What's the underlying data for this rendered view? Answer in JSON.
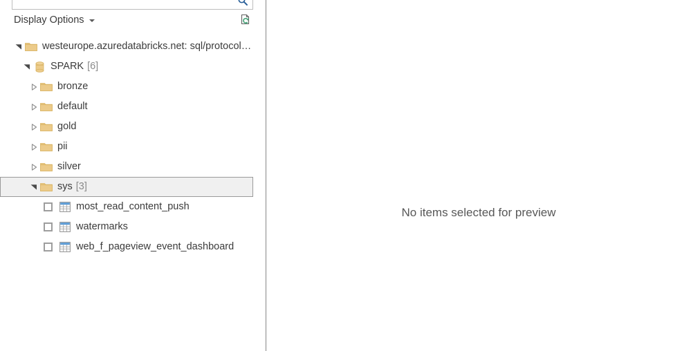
{
  "search": {
    "value": "",
    "placeholder": "",
    "icon": "search-icon"
  },
  "toolbar": {
    "display_options_label": "Display Options",
    "dropdown_icon": "chevron-down-icon",
    "refresh_icon": "refresh-page-icon"
  },
  "tree": {
    "nodes": [
      {
        "label": "westeurope.azuredatabricks.net: sql/protocolv...",
        "count": "",
        "icon": "folder-icon",
        "state": "expanded",
        "level": 0,
        "selected": false,
        "checkbox": false
      },
      {
        "label": "SPARK",
        "count": "[6]",
        "icon": "database-icon",
        "state": "expanded",
        "level": 1,
        "selected": false,
        "checkbox": false
      },
      {
        "label": "bronze",
        "count": "",
        "icon": "folder-icon",
        "state": "collapsed",
        "level": 2,
        "selected": false,
        "checkbox": false
      },
      {
        "label": "default",
        "count": "",
        "icon": "folder-icon",
        "state": "collapsed",
        "level": 2,
        "selected": false,
        "checkbox": false
      },
      {
        "label": "gold",
        "count": "",
        "icon": "folder-icon",
        "state": "collapsed",
        "level": 2,
        "selected": false,
        "checkbox": false
      },
      {
        "label": "pii",
        "count": "",
        "icon": "folder-icon",
        "state": "collapsed",
        "level": 2,
        "selected": false,
        "checkbox": false
      },
      {
        "label": "silver",
        "count": "",
        "icon": "folder-icon",
        "state": "collapsed",
        "level": 2,
        "selected": false,
        "checkbox": false
      },
      {
        "label": "sys",
        "count": "[3]",
        "icon": "folder-icon",
        "state": "expanded",
        "level": 2,
        "selected": true,
        "checkbox": false
      },
      {
        "label": "most_read_content_push",
        "count": "",
        "icon": "table-icon",
        "state": "leaf",
        "level": 3,
        "selected": false,
        "checkbox": true,
        "checked": false
      },
      {
        "label": "watermarks",
        "count": "",
        "icon": "table-icon",
        "state": "leaf",
        "level": 3,
        "selected": false,
        "checkbox": true,
        "checked": false
      },
      {
        "label": "web_f_pageview_event_dashboard",
        "count": "",
        "icon": "table-icon",
        "state": "leaf",
        "level": 3,
        "selected": false,
        "checkbox": true,
        "checked": false
      }
    ]
  },
  "preview": {
    "empty_message": "No items selected for preview"
  },
  "colors": {
    "folder": "#e8c67f",
    "folder_dark": "#ddb968",
    "table_header": "#5b9bd5",
    "divider": "#868686",
    "selected_bg": "#f0f0f0",
    "selected_border": "#9a9a9a",
    "text": "#3b3b3b",
    "muted_text": "#8a8a8a",
    "search_icon": "#2a6099",
    "refresh_green": "#4ea77e"
  }
}
